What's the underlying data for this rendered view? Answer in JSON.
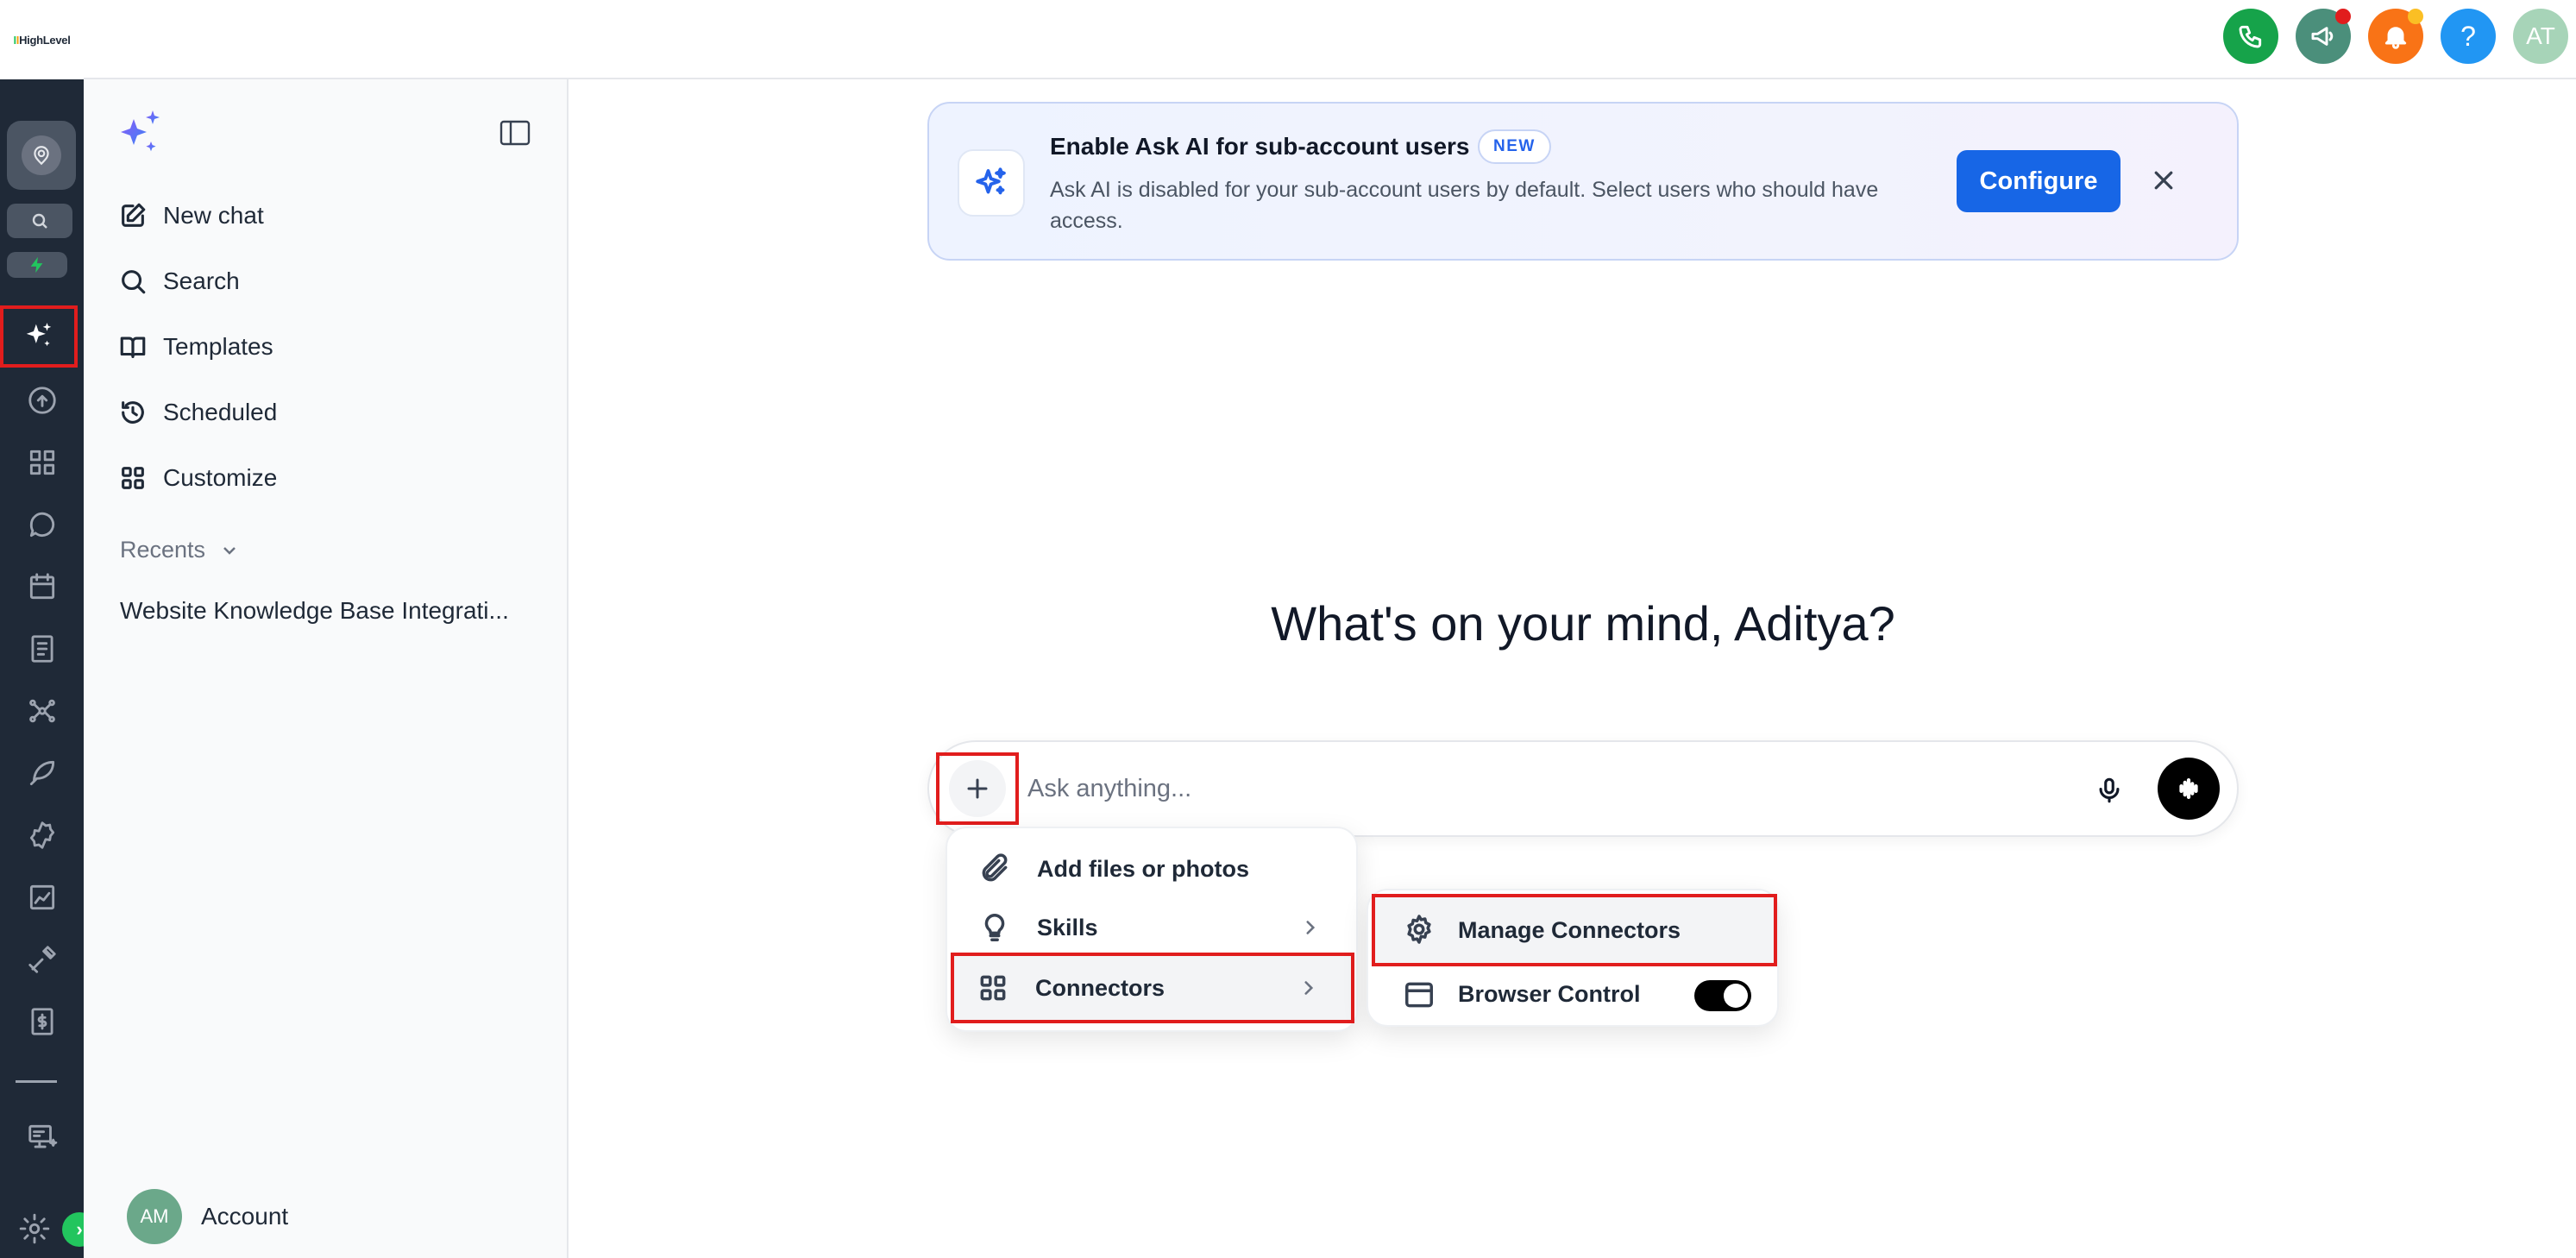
{
  "app": {
    "logo_text": "HighLevel"
  },
  "header": {
    "avatar_initials": "AT",
    "help_label": "?",
    "colors": {
      "phone": "#16a34a",
      "megaphone": "#4b8f7b",
      "bell": "#f97316",
      "help": "#2196f3",
      "avatar": "#a7d4b8"
    }
  },
  "sidebar": {
    "items": [
      {
        "label": "New chat",
        "icon": "edit-icon"
      },
      {
        "label": "Search",
        "icon": "search-icon"
      },
      {
        "label": "Templates",
        "icon": "book-icon"
      },
      {
        "label": "Scheduled",
        "icon": "history-icon"
      },
      {
        "label": "Customize",
        "icon": "grid-icon"
      }
    ],
    "recents_label": "Recents",
    "recent_items": [
      "Website Knowledge Base Integrati..."
    ],
    "account": {
      "initials": "AM",
      "label": "Account"
    }
  },
  "banner": {
    "title": "Enable Ask AI for sub-account users",
    "badge": "NEW",
    "description": "Ask AI is disabled for your sub-account users by default. Select users who should have access.",
    "configure_label": "Configure"
  },
  "main": {
    "greeting": "What's on your mind, Aditya?",
    "input_placeholder": "Ask anything..."
  },
  "menu": {
    "items": [
      {
        "label": "Add files or photos",
        "icon": "paperclip-icon"
      },
      {
        "label": "Skills",
        "icon": "lightbulb-icon"
      },
      {
        "label": "Connectors",
        "icon": "grid-icon"
      }
    ]
  },
  "submenu": {
    "items": [
      {
        "label": "Manage Connectors",
        "icon": "gear-icon"
      },
      {
        "label": "Browser Control",
        "icon": "browser-icon",
        "toggle_on": true
      }
    ]
  },
  "accent_color": "#1766e6",
  "highlight_color": "#e11d1d"
}
